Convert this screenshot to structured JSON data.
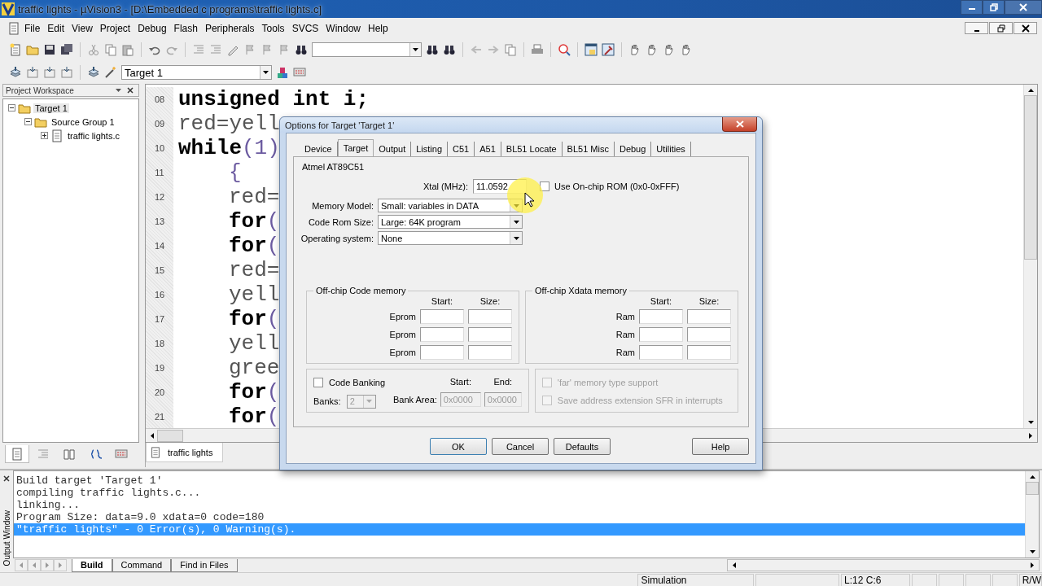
{
  "window": {
    "title": "traffic lights  - µVision3 - [D:\\Embedded c programs\\traffic lights.c]"
  },
  "menu": [
    "File",
    "Edit",
    "View",
    "Project",
    "Debug",
    "Flash",
    "Peripherals",
    "Tools",
    "SVCS",
    "Window",
    "Help"
  ],
  "target_select": {
    "value": "Target 1"
  },
  "workspace": {
    "title": "Project Workspace",
    "tree": [
      {
        "label": "Target 1",
        "kind": "target",
        "expanded": true,
        "selected": true,
        "children": [
          {
            "label": "Source Group 1",
            "kind": "group",
            "expanded": true,
            "selected": false,
            "children": [
              {
                "label": "traffic lights.c",
                "kind": "file",
                "expanded": false,
                "selected": false
              }
            ]
          }
        ]
      }
    ]
  },
  "workspace_tabs": [
    {
      "selected": true
    },
    {
      "selected": false
    },
    {
      "selected": false
    },
    {
      "selected": false
    },
    {
      "selected": false
    }
  ],
  "editor": {
    "tab": "traffic lights",
    "lines": [
      {
        "number": "08",
        "indented": false,
        "tokens": [
          {
            "text": "unsigned int i;",
            "kind": "bold"
          }
        ]
      },
      {
        "number": "09",
        "indented": false,
        "tokens": [
          {
            "text": "red=yell",
            "kind": "plain"
          }
        ]
      },
      {
        "number": "10",
        "indented": false,
        "tokens": [
          {
            "text": "while",
            "kind": "bold"
          },
          {
            "text": "(1)",
            "kind": "symbol"
          }
        ]
      },
      {
        "number": "11",
        "indented": true,
        "tokens": [
          {
            "text": "{",
            "kind": "symbol"
          }
        ]
      },
      {
        "number": "12",
        "indented": true,
        "tokens": [
          {
            "text": "red=",
            "kind": "plain"
          }
        ]
      },
      {
        "number": "13",
        "indented": true,
        "tokens": [
          {
            "text": "for",
            "kind": "bold"
          },
          {
            "text": "(",
            "kind": "symbol"
          }
        ]
      },
      {
        "number": "14",
        "indented": true,
        "tokens": [
          {
            "text": "for",
            "kind": "bold"
          },
          {
            "text": "(",
            "kind": "symbol"
          }
        ]
      },
      {
        "number": "15",
        "indented": true,
        "tokens": [
          {
            "text": "red=",
            "kind": "plain"
          }
        ]
      },
      {
        "number": "16",
        "indented": true,
        "tokens": [
          {
            "text": "yell",
            "kind": "plain"
          }
        ]
      },
      {
        "number": "17",
        "indented": true,
        "tokens": [
          {
            "text": "for",
            "kind": "bold"
          },
          {
            "text": "(",
            "kind": "symbol"
          }
        ]
      },
      {
        "number": "18",
        "indented": true,
        "tokens": [
          {
            "text": "yell",
            "kind": "plain"
          }
        ]
      },
      {
        "number": "19",
        "indented": true,
        "tokens": [
          {
            "text": "gree",
            "kind": "plain"
          }
        ]
      },
      {
        "number": "20",
        "indented": true,
        "tokens": [
          {
            "text": "for",
            "kind": "bold"
          },
          {
            "text": "(",
            "kind": "symbol"
          }
        ]
      },
      {
        "number": "21",
        "indented": true,
        "tokens": [
          {
            "text": "for",
            "kind": "bold"
          },
          {
            "text": "(",
            "kind": "symbol"
          }
        ]
      }
    ]
  },
  "output": {
    "title": "Output Window",
    "lines": [
      {
        "text": "Build target 'Target 1'",
        "selected": false
      },
      {
        "text": "compiling traffic lights.c...",
        "selected": false
      },
      {
        "text": "linking...",
        "selected": false
      },
      {
        "text": "Program Size: data=9.0 xdata=0 code=180",
        "selected": false
      },
      {
        "text": "\"traffic lights\" - 0 Error(s), 0 Warning(s).",
        "selected": true
      }
    ],
    "tabs": [
      {
        "label": "Build",
        "selected": true
      },
      {
        "label": "Command",
        "selected": false
      },
      {
        "label": "Find in Files",
        "selected": false
      }
    ]
  },
  "status_bar": {
    "mode": "Simulation",
    "position": "L:12 C:6",
    "access": "R/W"
  },
  "dialog": {
    "title": "Options for Target 'Target 1'",
    "tabs": [
      {
        "label": "Device",
        "selected": false
      },
      {
        "label": "Target",
        "selected": true
      },
      {
        "label": "Output",
        "selected": false
      },
      {
        "label": "Listing",
        "selected": false
      },
      {
        "label": "C51",
        "selected": false
      },
      {
        "label": "A51",
        "selected": false
      },
      {
        "label": "BL51 Locate",
        "selected": false
      },
      {
        "label": "BL51 Misc",
        "selected": false
      },
      {
        "label": "Debug",
        "selected": false
      },
      {
        "label": "Utilities",
        "selected": false
      }
    ],
    "device": "Atmel AT89C51",
    "xtal": {
      "label": "Xtal (MHz):",
      "value": "11.0592"
    },
    "onchip_rom": {
      "label": "Use On-chip ROM (0x0-0xFFF)",
      "checked": false
    },
    "selects": [
      {
        "label": "Memory Model:",
        "value": "Small: variables in DATA"
      },
      {
        "label": "Code Rom Size:",
        "value": "Large: 64K program"
      },
      {
        "label": "Operating system:",
        "value": "None"
      }
    ],
    "code_memory": {
      "title": "Off-chip Code memory",
      "start": "Start:",
      "size": "Size:",
      "rows": [
        "Eprom",
        "Eprom",
        "Eprom"
      ]
    },
    "xdata_memory": {
      "title": "Off-chip Xdata memory",
      "start": "Start:",
      "size": "Size:",
      "rows": [
        "Ram",
        "Ram",
        "Ram"
      ]
    },
    "banking": {
      "label": "Code Banking",
      "checked": false,
      "start": "Start:",
      "end": "End:",
      "banks_label": "Banks:",
      "banks": "2",
      "area_label": "Bank Area:",
      "area_start": "0x0000",
      "area_end": "0x0000"
    },
    "options": [
      {
        "label": "'far' memory type support",
        "checked": false,
        "disabled": true
      },
      {
        "label": "Save address extension SFR in interrupts",
        "checked": false,
        "disabled": true
      }
    ],
    "buttons": {
      "ok": "OK",
      "cancel": "Cancel",
      "defaults": "Defaults",
      "help": "Help"
    }
  }
}
